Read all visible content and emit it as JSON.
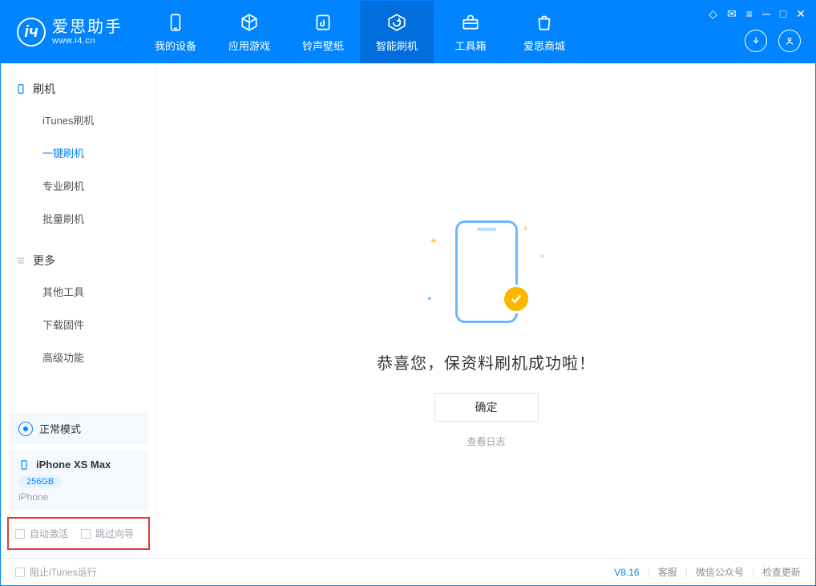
{
  "app": {
    "name": "爱思助手",
    "domain": "www.i4.cn"
  },
  "nav": {
    "items": [
      {
        "label": "我的设备",
        "icon": "device"
      },
      {
        "label": "应用游戏",
        "icon": "cube"
      },
      {
        "label": "铃声壁纸",
        "icon": "music"
      },
      {
        "label": "智能刷机",
        "icon": "refresh",
        "active": true
      },
      {
        "label": "工具箱",
        "icon": "toolbox"
      },
      {
        "label": "爱思商城",
        "icon": "store"
      }
    ]
  },
  "sidebar": {
    "group1": {
      "title": "刷机"
    },
    "items1": [
      {
        "label": "iTunes刷机"
      },
      {
        "label": "一键刷机",
        "active": true
      },
      {
        "label": "专业刷机"
      },
      {
        "label": "批量刷机"
      }
    ],
    "group2": {
      "title": "更多"
    },
    "items2": [
      {
        "label": "其他工具"
      },
      {
        "label": "下载固件"
      },
      {
        "label": "高级功能"
      }
    ],
    "mode": "正常模式",
    "device": {
      "name": "iPhone XS Max",
      "storage": "256GB",
      "type": "iPhone"
    },
    "chk_auto_activate": "自动激活",
    "chk_skip_guide": "跳过向导"
  },
  "main": {
    "success_text": "恭喜您，保资料刷机成功啦！",
    "ok_button": "确定",
    "view_log": "查看日志"
  },
  "footer": {
    "block_itunes": "阻止iTunes运行",
    "version": "V8.16",
    "links": [
      "客服",
      "微信公众号",
      "检查更新"
    ]
  }
}
